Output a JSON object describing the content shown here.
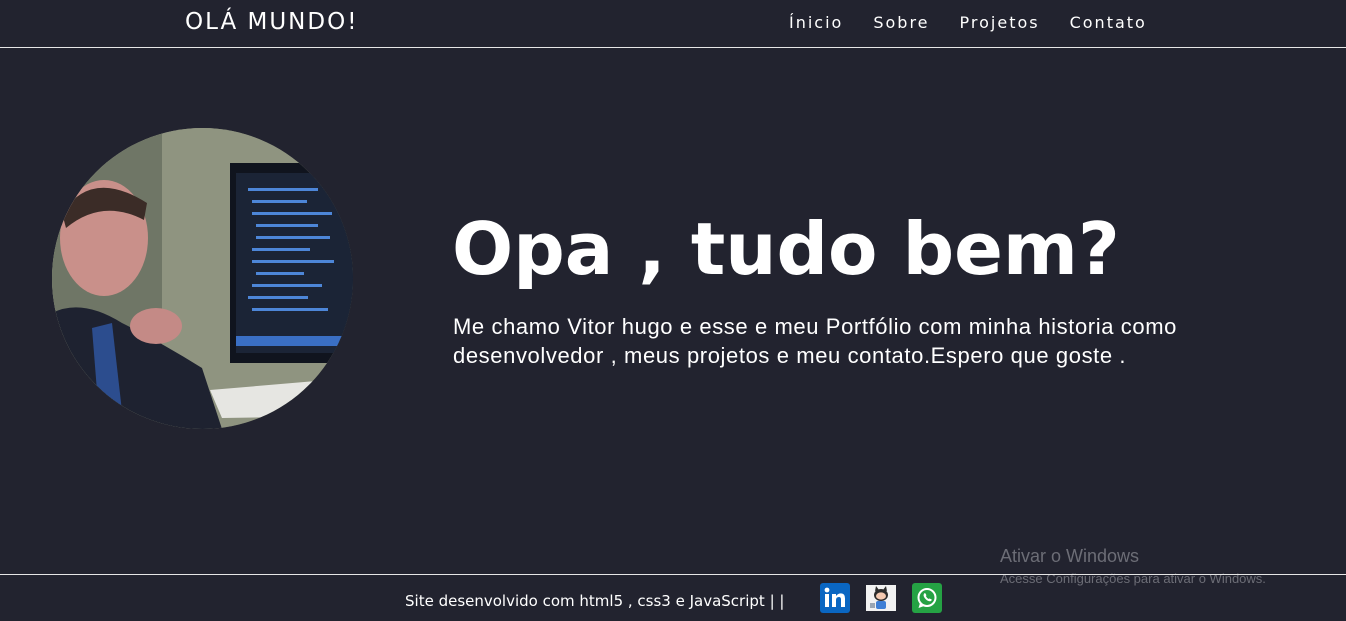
{
  "header": {
    "brand": "OLÁ MUNDO!",
    "nav": [
      "Ínicio",
      "Sobre",
      "Projetos",
      "Contato"
    ]
  },
  "hero": {
    "title": "Opa , tudo bem?",
    "text": "Me chamo Vitor hugo e esse e meu Portfólio com minha historia como desenvolvedor , meus projetos e meu contato.Espero que goste ."
  },
  "footer": {
    "text": "Site desenvolvido com html5 , css3 e JavaScript | |",
    "icons": [
      "linkedin-icon",
      "github-icon",
      "whatsapp-icon"
    ]
  },
  "watermark": {
    "title": "Ativar o Windows",
    "subtitle": "Acesse Configurações para ativar o Windows."
  },
  "colors": {
    "background": "#22232f",
    "text": "#ffffff",
    "linkedin": "#0a66c2",
    "whatsapp": "#25a244"
  }
}
